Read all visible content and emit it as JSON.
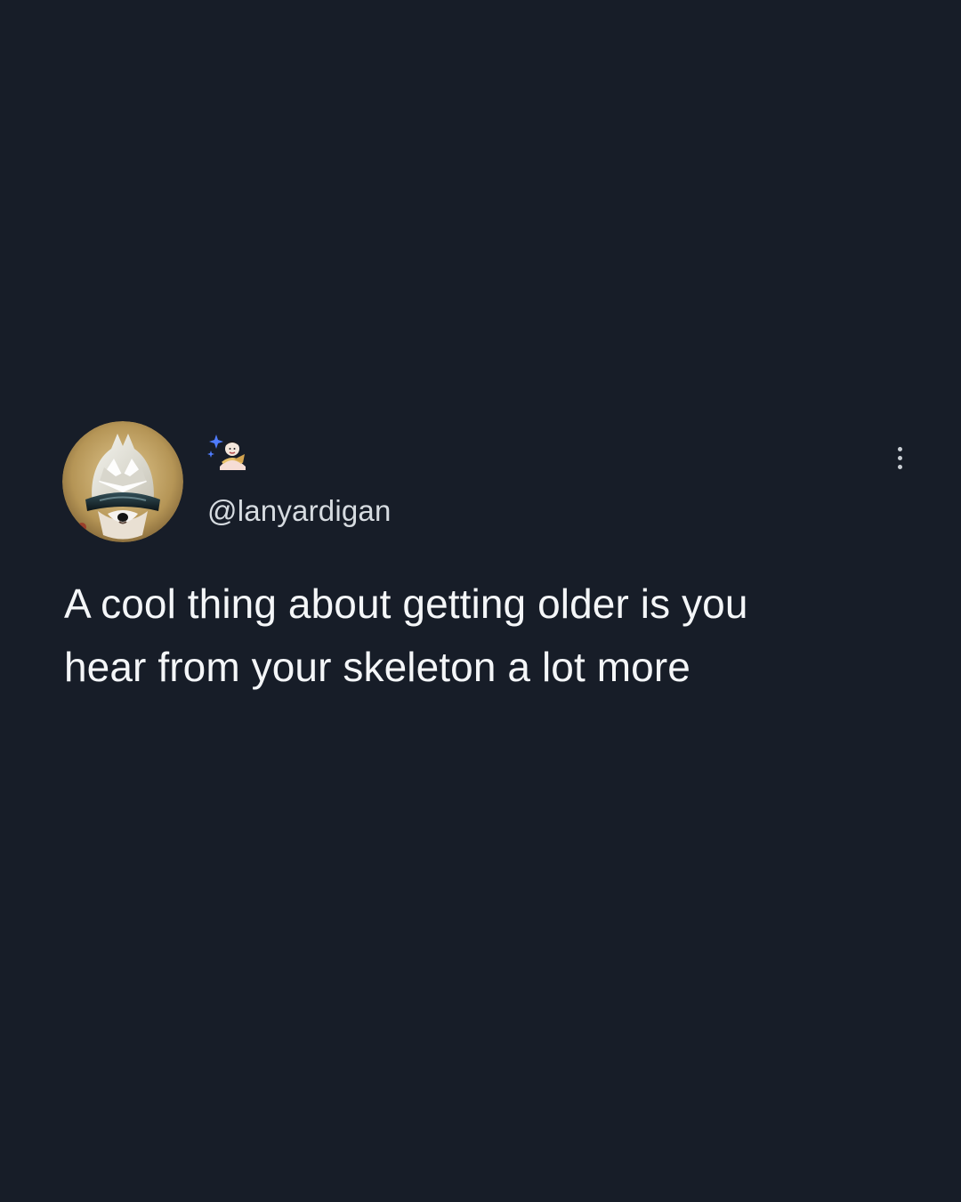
{
  "tweet": {
    "handle": "@lanyardigan",
    "name_icon": "sparkle-mage-emoji-icon",
    "avatar_icon": "armored-dog-helmet-avatar",
    "more_icon": "vertical-ellipsis-icon",
    "text_lines": [
      "A cool thing about getting older is you",
      "hear from your skeleton a lot more"
    ]
  },
  "colors": {
    "background": "#171d28",
    "text": "#f4f6f8",
    "handle": "#d6dbe0",
    "sparkle": "#4f7cff",
    "avatar_ring": "#b89c68"
  }
}
